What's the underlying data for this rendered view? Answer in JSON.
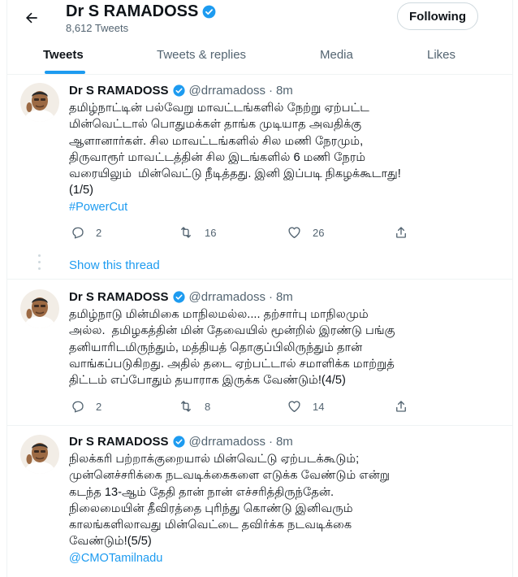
{
  "header": {
    "name": "Dr S RAMADOSS",
    "tweet_count": "8,612 Tweets",
    "follow_label": "Following"
  },
  "tabs": [
    {
      "label": "Tweets"
    },
    {
      "label": "Tweets & replies"
    },
    {
      "label": "Media"
    },
    {
      "label": "Likes"
    }
  ],
  "tweets": [
    {
      "name": "Dr S RAMADOSS",
      "handle": "@drramadoss",
      "dot": "·",
      "time": "8m",
      "text": "தமிழ்நாட்டின் பல்வேறு மாவட்டங்களில் நேற்று ஏற்பட்ட\nமின்வெட்டால் பொதுமக்கள் தாங்க முடியாத அவதிக்கு\nஆளானார்கள். சில மாவட்டங்களில் சில மணி நேரமும்,\nதிருவாரூர் மாவட்டத்தின் சில இடங்களில் 6 மணி நேரம்\nவரையிலும்  மின்வெட்டு நீடித்தது. இனி இப்படி நிகழக்கூடாது!\n(1/5)",
      "link": "#PowerCut",
      "replies": "2",
      "retweets": "16",
      "likes": "26"
    },
    {
      "name": "Dr S RAMADOSS",
      "handle": "@drramadoss",
      "dot": "·",
      "time": "8m",
      "text": "தமிழ்நாடு மின்மிகை மாநிலமல்ல.... தற்சார்பு மாநிலமும்\nஅல்ல.  தமிழகத்தின் மின் தேவையில் மூன்றில் இரண்டு பங்கு\nதனியாரிடமிருந்தும், மத்தியத் தொகுப்பிலிருந்தும் தான்\nவாங்கப்படுகிறது. அதில் தடை ஏற்பட்டால் சமாளிக்க மாற்றுத்\nதிட்டம் எப்போதும் தயாராக இருக்க வேண்டும்!(4/5)",
      "replies": "2",
      "retweets": "8",
      "likes": "14"
    },
    {
      "name": "Dr S RAMADOSS",
      "handle": "@drramadoss",
      "dot": "·",
      "time": "8m",
      "text": "நிலக்கரி பற்றாக்குறையால் மின்வெட்டு ஏற்படக்கூடும்;\nமுன்னெச்சரிக்கை நடவடிக்கைகளை எடுக்க வேண்டும் என்று\nகடந்த 13-ஆம் தேதி தான் நான் எச்சரித்திருந்தேன்.\nநிலைமையின் தீவிரத்தை புரிந்து கொண்டு இனிவரும்\nகாலங்களிலாவது மின்வெட்டை தவிர்க்க நடவடிக்கை\nவேண்டும்!(5/5)",
      "link": "@CMOTamilnadu"
    }
  ],
  "show_thread": "Show this thread",
  "colors": {
    "accent": "#1d9bf0",
    "text": "#0f1419",
    "muted": "#536471"
  }
}
